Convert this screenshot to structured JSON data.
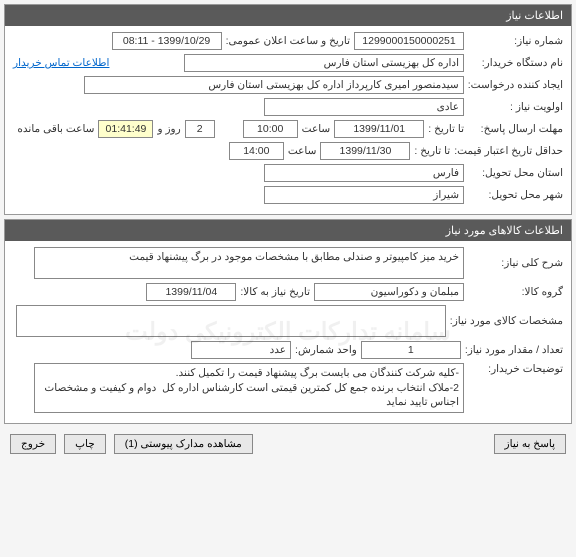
{
  "section1": {
    "title": "اطلاعات نیاز",
    "need_no_label": "شماره نیاز:",
    "need_no": "1299000150000251",
    "public_date_label": "تاریخ و ساعت اعلان عمومی:",
    "public_date": "1399/10/29 - 08:11",
    "buyer_org_label": "نام دستگاه خریدار:",
    "buyer_org": "اداره کل بهزیستی استان فارس",
    "contact_btn": "اطلاعات تماس خریدار",
    "creator_label": "ایجاد کننده درخواست:",
    "creator": "سیدمنصور امیری کارپرداز اداره کل بهزیستی استان فارس",
    "priority_label": "اولویت نیاز :",
    "priority": "عادی",
    "deadline_label": "مهلت ارسال پاسخ:",
    "to_date_label": "تا تاریخ :",
    "deadline_date": "1399/11/01",
    "time_label": "ساعت",
    "deadline_time": "10:00",
    "days": "2",
    "days_label": "روز و",
    "remaining_time": "01:41:49",
    "remaining_label": "ساعت باقی مانده",
    "min_credit_label": "حداقل تاریخ اعتبار قیمت:",
    "credit_to_label": "تا تاریخ :",
    "credit_date": "1399/11/30",
    "credit_time": "14:00",
    "province_label": "استان محل تحویل:",
    "province": "فارس",
    "city_label": "شهر محل تحویل:",
    "city": "شیراز"
  },
  "section2": {
    "title": "اطلاعات کالاهای مورد نیاز",
    "desc_label": "شرح کلی نیاز:",
    "desc": "خرید میز کامپیوتر و صندلی مطابق با مشخصات موجود در برگ پیشنهاد قیمت",
    "group_label": "گروه کالا:",
    "group": "مبلمان و دکوراسیون",
    "need_date_label": "تاریخ نیاز به کالا:",
    "need_date": "1399/11/04",
    "spec_label": "مشخصات کالای مورد نیاز:",
    "spec": "",
    "qty_label": "تعداد / مقدار مورد نیاز:",
    "qty": "1",
    "unit_label": "واحد شمارش:",
    "unit": "عدد",
    "buyer_notes_label": "توضیحات خریدار:",
    "buyer_notes": "-کلیه شرکت کنندگان می بایست برگ پیشنهاد قیمت را تکمیل کنند.\n2-ملاک انتخاب برنده جمع کل کمترین قیمتی است کارشناس اداره کل  دوام و کیفیت و مشخصات اجناس تایید نماید",
    "watermark": "سامانه تدارکات الکترونیکی دولت"
  },
  "footer": {
    "reply": "پاسخ به نیاز",
    "attach": "مشاهده مدارک پیوستی (1)",
    "print": "چاپ",
    "exit": "خروج"
  }
}
